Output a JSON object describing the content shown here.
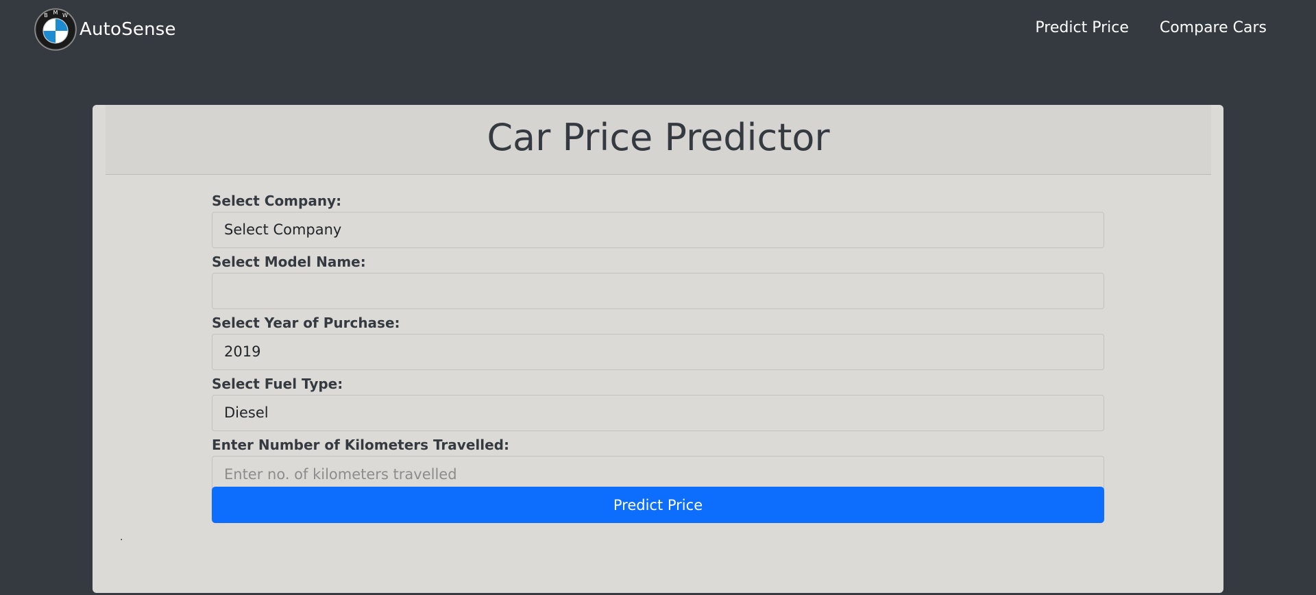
{
  "navbar": {
    "brand": "AutoSense",
    "logo_letters": [
      "B",
      "M",
      "W"
    ],
    "links": [
      "Predict Price",
      "Compare Cars"
    ]
  },
  "card": {
    "title": "Car Price Predictor"
  },
  "form": {
    "company": {
      "label": "Select Company:",
      "value": "Select Company"
    },
    "model": {
      "label": "Select Model Name:",
      "value": ""
    },
    "year": {
      "label": "Select Year of Purchase:",
      "value": "2019"
    },
    "fuel": {
      "label": "Select Fuel Type:",
      "value": "Diesel"
    },
    "kms": {
      "label": "Enter Number of Kilometers Travelled:",
      "placeholder": "Enter no. of kilometers travelled"
    },
    "submit_label": "Predict Price"
  },
  "result": {
    "text": "."
  },
  "colors": {
    "page_bg": "#343a40",
    "card_bg": "#dcdad6",
    "button": "#0d6efd",
    "logo_blue": "#1c8bd0"
  }
}
